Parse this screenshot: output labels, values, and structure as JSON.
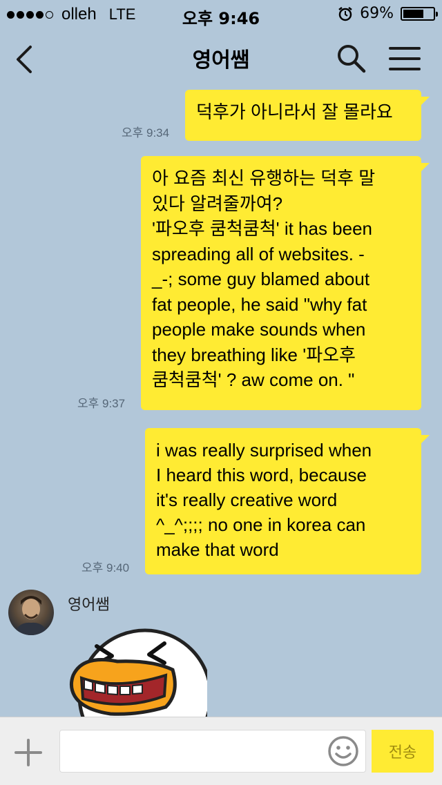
{
  "status_bar": {
    "carrier": "olleh",
    "network": "LTE",
    "time": "오후 9:46",
    "battery": "69%",
    "battery_level": 0.69
  },
  "header": {
    "title": "영어쌤",
    "back_icon": "chevron-left-icon",
    "search_icon": "search-icon",
    "menu_icon": "hamburger-menu-icon"
  },
  "messages": [
    {
      "text": "덕후가 아니라서 잘 몰라요",
      "time": "오후 9:34",
      "mine": true
    },
    {
      "text": "아 요즘 최신 유행하는 덕후 말\n있다 알려줄까여?\n'파오후 쿰척쿰척' it has been\nspreading all of websites. -\n_-; some guy blamed about\nfat people, he said \"why fat\npeople make sounds when\nthey breathing like '파오후\n쿰척쿰척' ? aw come on. \"",
      "time": "오후 9:37",
      "mine": true
    },
    {
      "text": "i was really surprised when\nI heard this word, because\nit's really creative word\n^_^;;;; no one in korea can\nmake that word",
      "time": "오후 9:40",
      "mine": true
    }
  ],
  "incoming": {
    "sender": "영어쌤",
    "sticker": "laughing-duck-sticker"
  },
  "input_bar": {
    "placeholder": "",
    "send_label": "전송",
    "plus_icon": "plus-icon",
    "emoji_icon": "emoji-icon"
  },
  "colors": {
    "background": "#b2c7d9",
    "bubble": "#ffeb33",
    "input_bar": "#eeeeee"
  }
}
